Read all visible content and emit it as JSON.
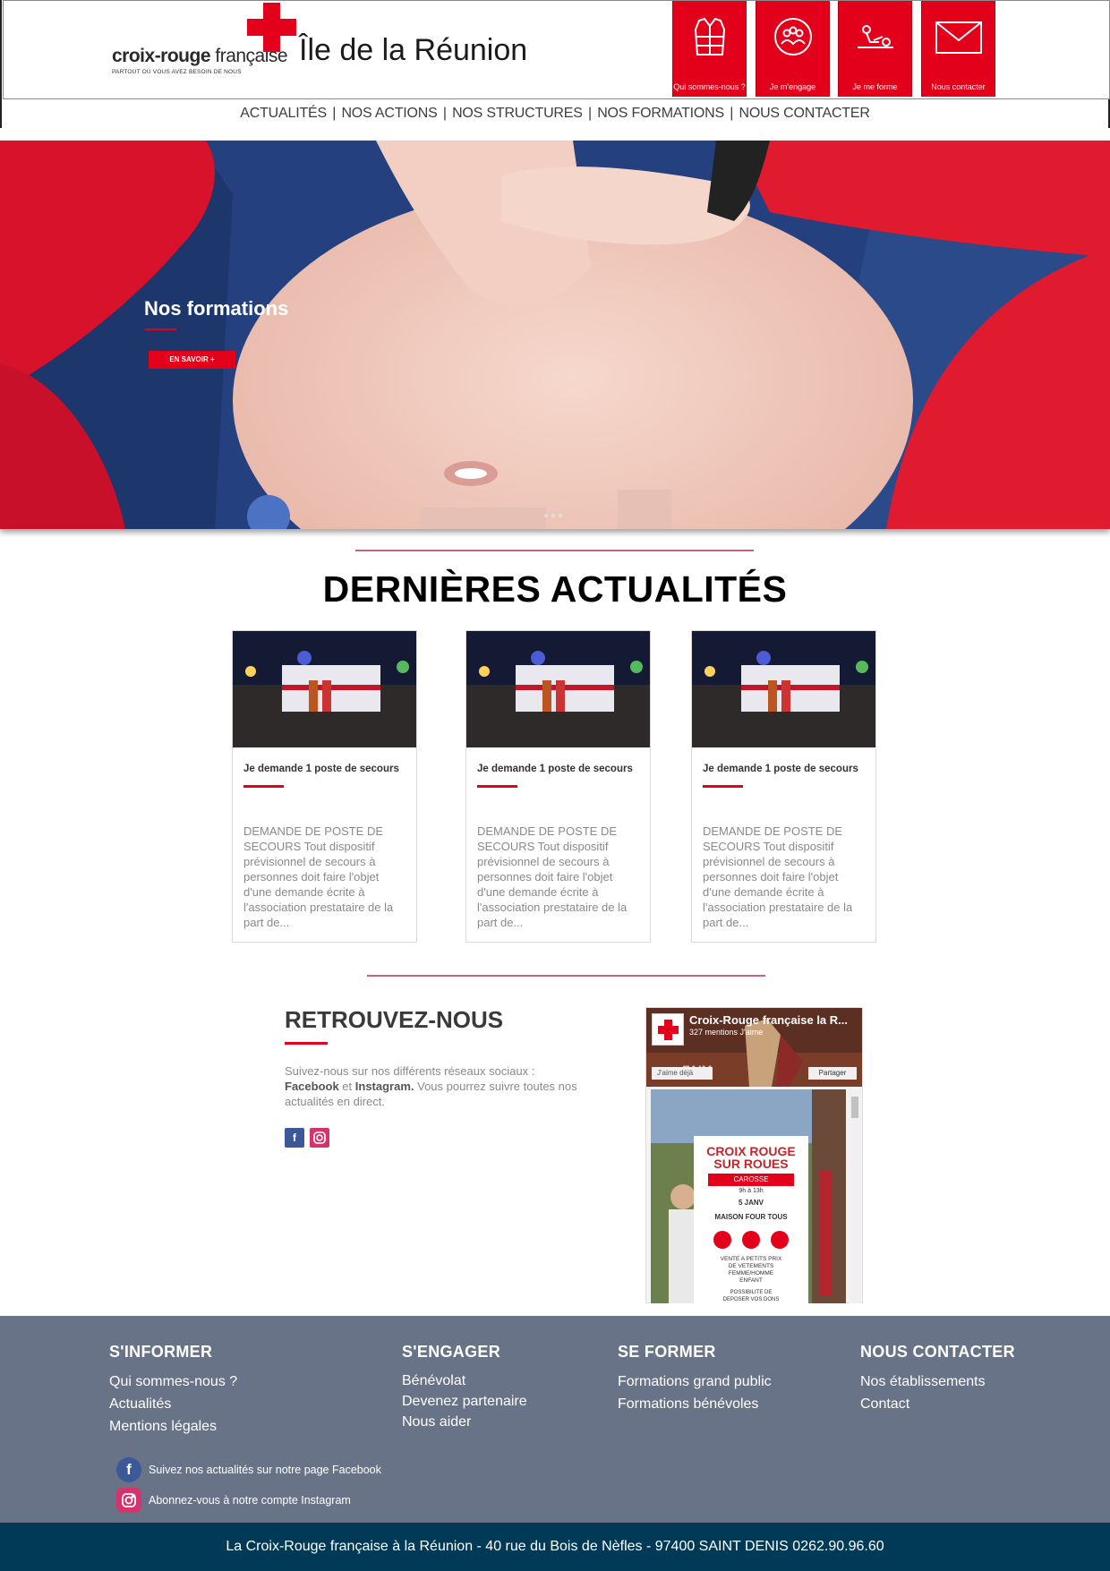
{
  "header": {
    "brand_prefix": "croix-rouge",
    "brand_suffix": " française",
    "brand_tagline": "PARTOUT OÙ VOUS AVEZ BESOIN DE NOUS",
    "region": "Île de la Réunion",
    "tiles": [
      {
        "label": "Qui sommes-nous ?",
        "icon": "vest-icon"
      },
      {
        "label": "Je m'engage",
        "icon": "community-icon"
      },
      {
        "label": "Je me forme",
        "icon": "first-aid-training-icon"
      },
      {
        "label": "Nous contacter",
        "icon": "envelope-icon"
      }
    ]
  },
  "nav": {
    "items": [
      "ACTUALITÉS",
      "NOS ACTIONS",
      "NOS STRUCTURES",
      "NOS FORMATIONS",
      "NOUS CONTACTER"
    ],
    "separator": "|"
  },
  "hero": {
    "title": "Nos formations",
    "button": "EN SAVOIR +"
  },
  "news": {
    "title": "DERNIÈRES ACTUALITÉS",
    "cards": [
      {
        "title": "Je demande 1 poste de secours",
        "excerpt": "DEMANDE DE POSTE DE SECOURS Tout dispositif prévisionnel de secours à personnes doit faire l'objet d'une demande écrite à l'association prestataire de la part de..."
      },
      {
        "title": "Je demande 1 poste de secours",
        "excerpt": "DEMANDE DE POSTE DE SECOURS Tout dispositif prévisionnel de secours à personnes doit faire l'objet d'une demande écrite à l'association prestataire de la part de..."
      },
      {
        "title": "Je demande 1 poste de secours",
        "excerpt": "DEMANDE DE POSTE DE SECOURS Tout dispositif prévisionnel de secours à personnes doit faire l'objet d'une demande écrite à l'association prestataire de la part de..."
      }
    ]
  },
  "social": {
    "title": "RETROUVEZ-NOUS",
    "text_1": "Suivez-nous sur nos différents réseaux sociaux :",
    "facebook": "Facebook",
    "and": " et ",
    "instagram": "Instagram.",
    "text_2": " Vous pourrez suivre toutes nos actualités en direct."
  },
  "fb_widget": {
    "page_name": "Croix-Rouge française la R...",
    "likes": "327 mentions J'aime",
    "like_button": "J'aime déjà",
    "share_button": "Partager",
    "poster": {
      "line1": "CROIX ROUGE",
      "line2": "SUR ROUES",
      "band": "CAROSSE",
      "hours": "9h à 13h",
      "date": "5 JANV",
      "place": "MAISON FOUR TOUS",
      "sale1": "VENTE A PETITS PRIX",
      "sale2": "DE VETEMENTS",
      "sale3": "FEMME/HOMME",
      "sale4": "ENFANT",
      "don1": "POSSIBILITE DE",
      "don2": "DEPOSER VOS DONS"
    }
  },
  "footer": {
    "columns": [
      {
        "title": "S'INFORMER",
        "links": [
          "Qui sommes-nous ?",
          "Actualités",
          "Mentions légales"
        ]
      },
      {
        "title": "S'ENGAGER",
        "links": [
          "Bénévolat",
          "Devenez partenaire",
          "Nous aider"
        ]
      },
      {
        "title": "SE FORMER",
        "links": [
          "Formations grand public",
          "Formations bénévoles"
        ]
      },
      {
        "title": "NOUS CONTACTER",
        "links": [
          "Nos établissements",
          "Contact"
        ]
      }
    ],
    "facebook_text": "Suivez nos actualités sur notre page Facebook",
    "instagram_text": "Abonnez-vous à notre compte Instagram",
    "address": "La Croix-Rouge française à la Réunion - 40 rue du Bois de Nèfles - 97400 SAINT DENIS 0262.90.96.60"
  },
  "colors": {
    "brand_red": "#e2001a",
    "divider_pink": "#c9637c",
    "footer_bg": "#687387",
    "bottom_bar": "#003a57"
  }
}
